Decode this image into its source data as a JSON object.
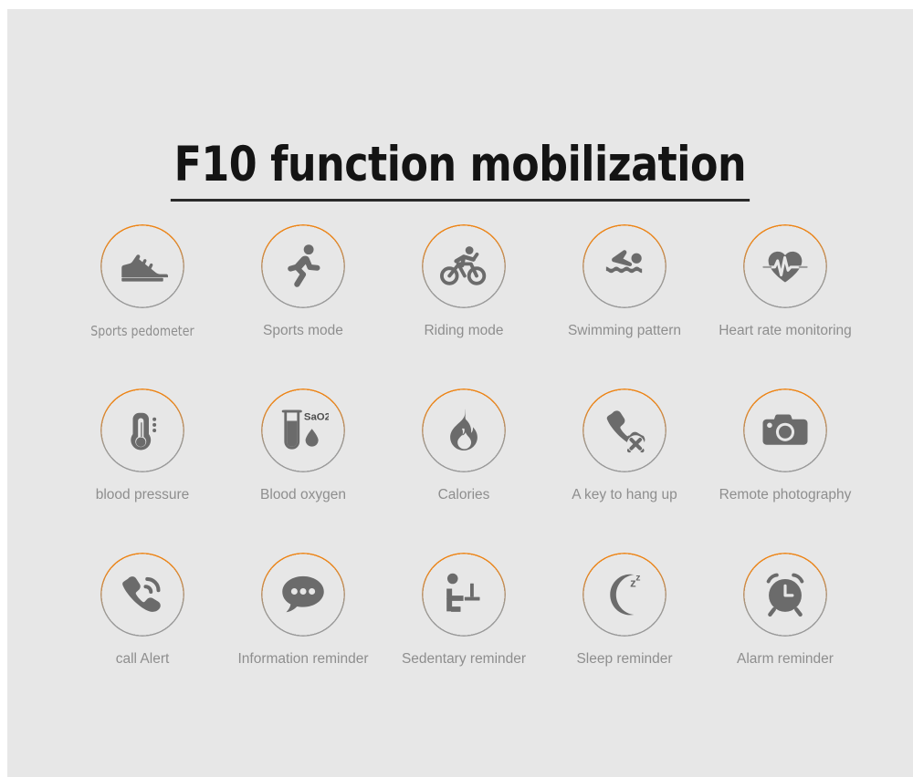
{
  "page": {
    "title": "F10 function mobilization",
    "background_color": "#e7e7e7",
    "accent_color": "#ef8413",
    "icon_color": "#6b6b6b",
    "caption_color": "#8e8e8e"
  },
  "features": [
    [
      {
        "label": "Sports pedometer",
        "icon": "shoe-icon"
      },
      {
        "label": "Sports mode",
        "icon": "running-person-icon"
      },
      {
        "label": "Riding mode",
        "icon": "cyclist-icon"
      },
      {
        "label": "Swimming pattern",
        "icon": "swimmer-icon"
      },
      {
        "label": "Heart rate monitoring",
        "icon": "heart-pulse-icon"
      }
    ],
    [
      {
        "label": "blood pressure",
        "icon": "thermometer-icon"
      },
      {
        "label": "Blood oxygen",
        "icon": "test-tube-icon",
        "icon_text": "SaO2"
      },
      {
        "label": "Calories",
        "icon": "flame-icon"
      },
      {
        "label": "A key to hang up",
        "icon": "phone-hangup-icon"
      },
      {
        "label": "Remote photography",
        "icon": "camera-icon"
      }
    ],
    [
      {
        "label": "call  Alert",
        "icon": "phone-ringing-icon"
      },
      {
        "label": "Information reminder",
        "icon": "speech-bubble-icon"
      },
      {
        "label": "Sedentary reminder",
        "icon": "seated-person-icon"
      },
      {
        "label": "Sleep reminder",
        "icon": "moon-zz-icon"
      },
      {
        "label": "Alarm reminder",
        "icon": "alarm-clock-icon"
      }
    ]
  ]
}
